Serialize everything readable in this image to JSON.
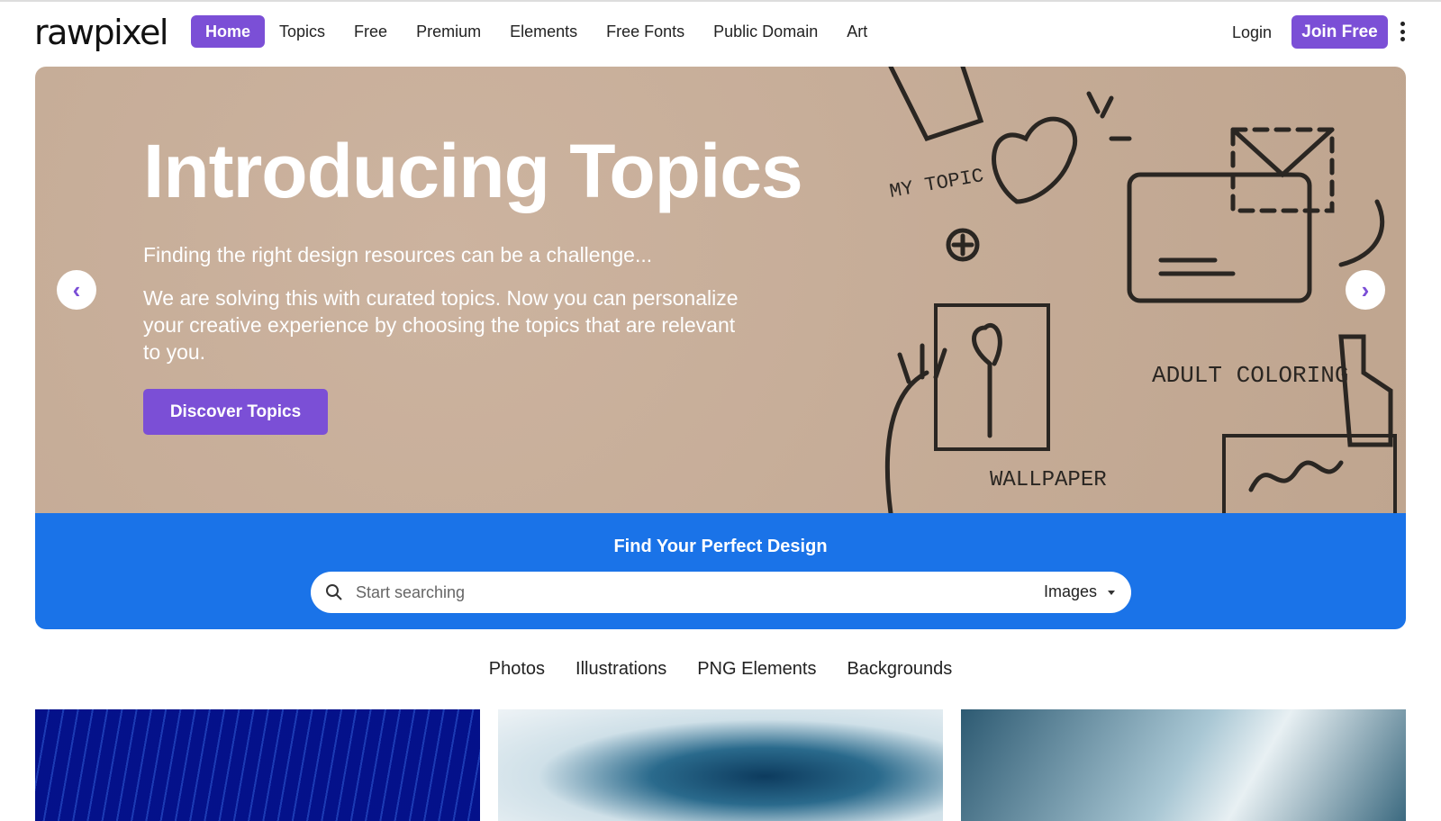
{
  "brand": {
    "logo": "rawpixel",
    "accent": "#7b4fd6",
    "band_color": "#1a73e8"
  },
  "nav": {
    "items": [
      {
        "label": "Home",
        "active": true
      },
      {
        "label": "Topics"
      },
      {
        "label": "Free"
      },
      {
        "label": "Premium"
      },
      {
        "label": "Elements"
      },
      {
        "label": "Free Fonts"
      },
      {
        "label": "Public Domain"
      },
      {
        "label": "Art"
      }
    ],
    "login": "Login",
    "join": "Join Free"
  },
  "hero": {
    "title": "Introducing Topics",
    "subtitle": "Finding the right design resources can be a challenge...",
    "body": "We are solving this with curated topics. Now you can personalize your creative experience by choosing the topics that are relevant to you.",
    "cta": "Discover Topics",
    "doodle_labels": [
      "MY TOPIC",
      "ADULT COLORING",
      "WALLPAPER"
    ]
  },
  "search": {
    "heading": "Find Your Perfect Design",
    "placeholder": "Start searching",
    "type": "Images"
  },
  "categories": [
    "Photos",
    "Illustrations",
    "PNG Elements",
    "Backgrounds"
  ]
}
